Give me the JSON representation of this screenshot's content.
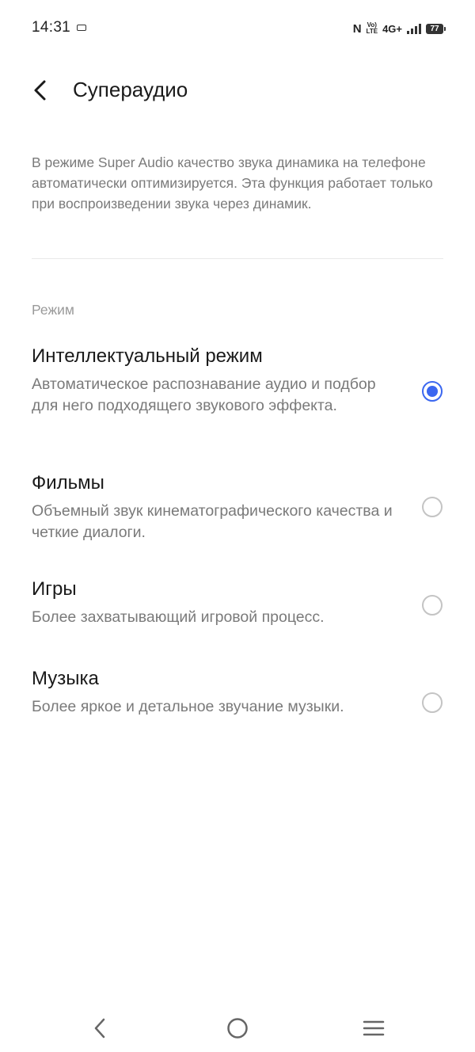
{
  "status_bar": {
    "time": "14:31",
    "volte": "VoLTE",
    "network": "4G+",
    "battery": "77"
  },
  "header": {
    "title": "Супераудио"
  },
  "description": "В режиме Super Audio качество звука динамика на телефоне автоматически оптимизируется. Эта функция работает только при воспроизведении звука через динамик.",
  "section_label": "Режим",
  "options": [
    {
      "title": "Интеллектуальный режим",
      "description": "Автоматическое распознавание аудио и подбор для него подходящего звукового эффекта.",
      "selected": true
    },
    {
      "title": "Фильмы",
      "description": "Объемный звук кинематографического качества и четкие диалоги.",
      "selected": false
    },
    {
      "title": "Игры",
      "description": "Более захватывающий игровой процесс.",
      "selected": false
    },
    {
      "title": "Музыка",
      "description": "Более яркое и детальное звучание музыки.",
      "selected": false
    }
  ],
  "colors": {
    "accent": "#3b67f0",
    "secondary_text": "#7a7a7a"
  },
  "icons": {
    "back": "chevron-left-icon",
    "nav_back": "nav-back-icon",
    "nav_home": "nav-home-icon",
    "nav_menu": "nav-menu-icon"
  }
}
